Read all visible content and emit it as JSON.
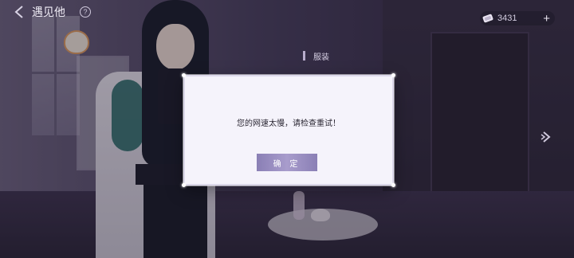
{
  "header": {
    "title": "遇见他",
    "help_symbol": "?"
  },
  "currency": {
    "value": "3431",
    "plus_symbol": "+"
  },
  "side_tab": {
    "label": "服装"
  },
  "dialog": {
    "message": "您的网速太慢，请检查重试！",
    "confirm_label": "确 定"
  },
  "colors": {
    "accent": "#9b8fc4",
    "dialog_bg": "#f5f3fb",
    "text_dark": "#2b2733"
  }
}
